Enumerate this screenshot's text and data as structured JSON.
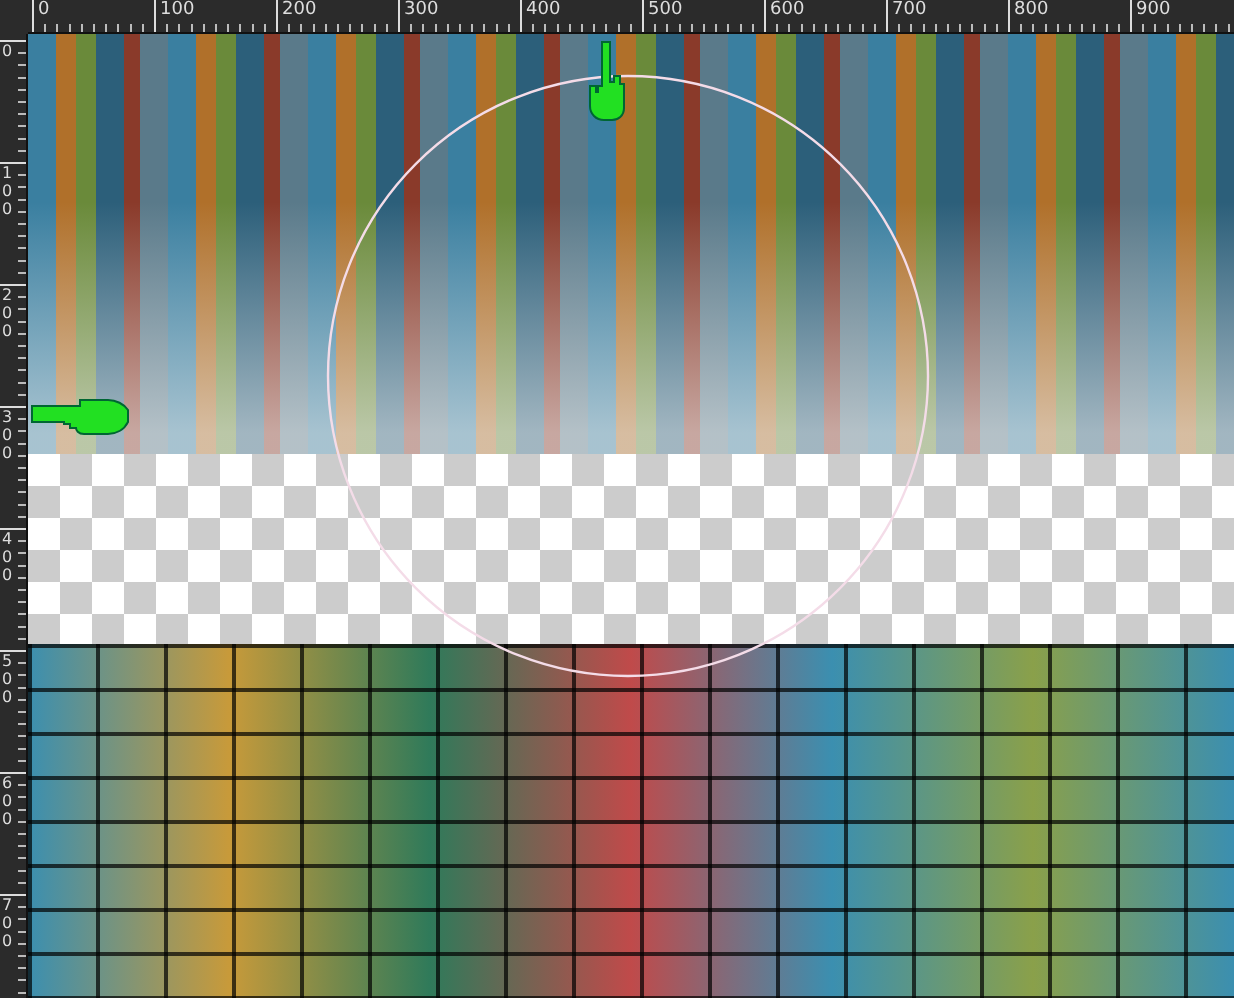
{
  "ruler_top": {
    "labels": [
      "0",
      "100",
      "200",
      "300",
      "400",
      "500",
      "600",
      "700",
      "800",
      "900"
    ]
  },
  "ruler_left": {
    "labels": [
      "0",
      "100",
      "200",
      "300",
      "400",
      "500",
      "600",
      "700"
    ]
  }
}
